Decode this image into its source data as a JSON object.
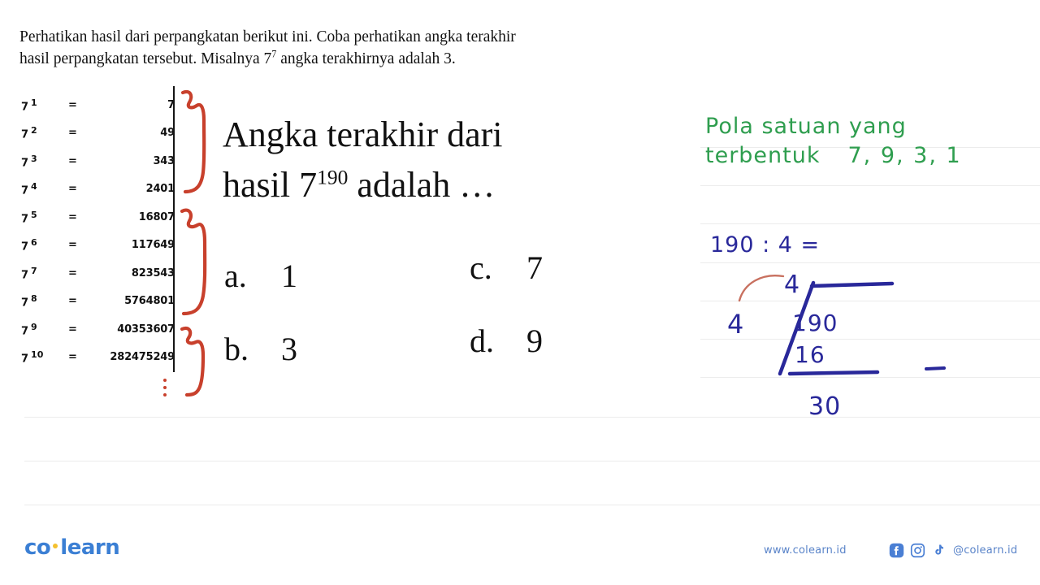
{
  "prompt": {
    "line1": "Perhatikan hasil dari perpangkatan berikut ini. Coba perhatikan angka terakhir",
    "line2_a": "hasil perpangkatan tersebut. Misalnya 7",
    "line2_sup": "7",
    "line2_b": " angka terakhirnya adalah 3."
  },
  "powers_table": {
    "base": "7",
    "equals": "=",
    "rows": [
      {
        "exp": "1",
        "value": "7"
      },
      {
        "exp": "2",
        "value": "49"
      },
      {
        "exp": "3",
        "value": "343"
      },
      {
        "exp": "4",
        "value": "2401"
      },
      {
        "exp": "5",
        "value": "16807"
      },
      {
        "exp": "6",
        "value": "117649"
      },
      {
        "exp": "7",
        "value": "823543"
      },
      {
        "exp": "8",
        "value": "5764801"
      },
      {
        "exp": "9",
        "value": "40353607"
      },
      {
        "exp": "10",
        "value": "282475249"
      }
    ],
    "continuation": "⋮"
  },
  "question": {
    "line1": "Angka terakhir dari",
    "line2_a": "hasil 7",
    "line2_sup": "190",
    "line2_b": " adalah …"
  },
  "options": [
    {
      "label": "a.",
      "value": "1"
    },
    {
      "label": "b.",
      "value": "3"
    },
    {
      "label": "c.",
      "value": "7"
    },
    {
      "label": "d.",
      "value": "9"
    }
  ],
  "annotations": {
    "green_line1": "Pola  satuan  yang",
    "green_line2": "terbentuk",
    "green_pattern": "7, 9, 3, 1",
    "blue_division_header": "190 : 4  =",
    "blue_quotient": "4",
    "blue_divisor": "4",
    "blue_dividend": "190",
    "blue_subtrahend": "16",
    "blue_remainder": "30"
  },
  "footer": {
    "logo_a": "co",
    "logo_b": "learn",
    "website": "www.colearn.id",
    "handle": "@colearn.id",
    "icons": [
      "facebook-icon",
      "instagram-icon",
      "tiktok-icon"
    ]
  },
  "colors": {
    "green_ink": "#2f9e4f",
    "blue_ink": "#29289a",
    "red_ink": "#c8402c",
    "brand_blue": "#3b7fd4",
    "brand_yellow": "#f4c02e",
    "rule_line": "#ececec"
  }
}
